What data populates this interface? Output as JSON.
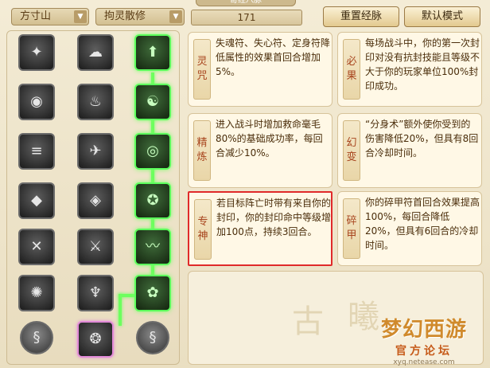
{
  "header": {
    "tab_title": "奇经八脉",
    "school_select": "方寸山",
    "branch_select": "拘灵散修",
    "points": "171",
    "reset_button": "重置经脉",
    "default_button": "默认模式"
  },
  "icons": {
    "dropdown_arrow": "▼"
  },
  "cards": [
    {
      "tag": "灵咒",
      "desc": "失魂符、失心符、定身符降低属性的效果首回合增加5%。"
    },
    {
      "tag": "必果",
      "desc": "每场战斗中，你的第一次封印对没有抗封技能且等级不大于你的玩家单位100%封印成功。"
    },
    {
      "tag": "精炼",
      "desc": "进入战斗时增加救命毫毛80%的基础成功率，每回合减少10%。"
    },
    {
      "tag": "幻变",
      "desc": "“分身术”额外使你受到的伤害降低20%，但具有8回合冷却时间。"
    },
    {
      "tag": "专神",
      "desc": "若目标阵亡时带有来自你的封印，你的封印命中等级增加100点，持续3回合。"
    },
    {
      "tag": "碎甲",
      "desc": "你的碎甲符首回合效果提高100%，每回合降低20%，但具有6回合的冷却时间。"
    }
  ],
  "watermark": {
    "logo": "梦幻西游",
    "sub": "官方论坛",
    "url": "xyq.netease.com"
  },
  "colors": {
    "active_glow": "#5cff5c",
    "highlight_border": "#e02a2a",
    "tag_text": "#a8451e"
  }
}
